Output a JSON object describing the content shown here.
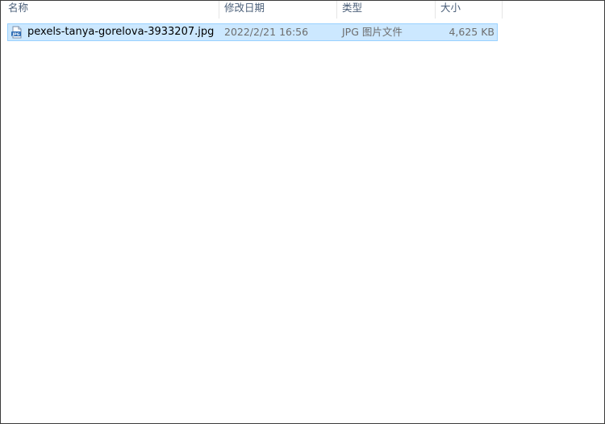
{
  "columns": {
    "name": "名称",
    "date": "修改日期",
    "type": "类型",
    "size": "大小"
  },
  "files": [
    {
      "name": "pexels-tanya-gorelova-3933207.jpg",
      "date": "2022/2/21 16:56",
      "type": "JPG 图片文件",
      "size": "4,625 KB",
      "icon": "jpg-file-icon",
      "selected": true
    }
  ],
  "colors": {
    "selection_bg": "#cce8ff",
    "selection_border": "#99d1ff",
    "header_text": "#4c607a",
    "secondary_text": "#6d6d6d"
  }
}
